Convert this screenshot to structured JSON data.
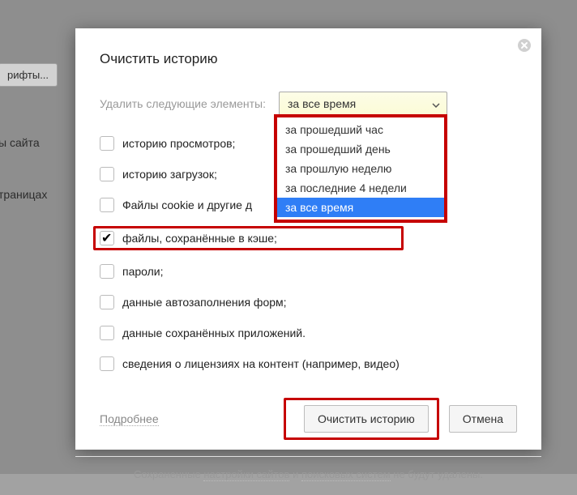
{
  "background": {
    "fonts_button": "рифты...",
    "site_label": "ы сайта",
    "pages_label": "траницах"
  },
  "dialog": {
    "title": "Очистить историю",
    "time_label": "Удалить следующие элементы:",
    "select_value": "за все время",
    "options": [
      "за прошедший час",
      "за прошедший день",
      "за прошлую неделю",
      "за последние 4 недели",
      "за все время"
    ],
    "items": [
      {
        "label": "историю просмотров;",
        "checked": false
      },
      {
        "label": "историю загрузок;",
        "checked": false
      },
      {
        "label": "Файлы cookie и другие д",
        "checked": false
      },
      {
        "label": "файлы, сохранённые в кэше;",
        "checked": true,
        "highlight": true
      },
      {
        "label": "пароли;",
        "checked": false
      },
      {
        "label": "данные автозаполнения форм;",
        "checked": false
      },
      {
        "label": "данные сохранённых приложений.",
        "checked": false
      },
      {
        "label": "сведения о лицензиях на контент (например, видео)",
        "checked": false
      }
    ],
    "more": "Подробнее",
    "confirm": "Очистить историю",
    "cancel": "Отмена",
    "footer_prefix": "Сохраненные ",
    "footer_link1": "настройки сайтов",
    "footer_mid": " и ",
    "footer_link2": "поисковых систем",
    "footer_suffix": " не будут удалены."
  }
}
